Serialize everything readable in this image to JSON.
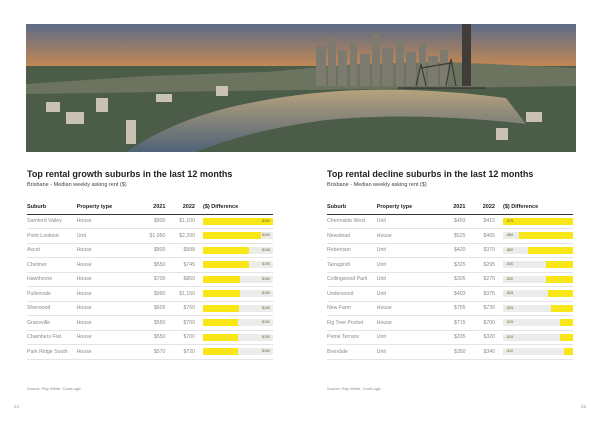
{
  "growth": {
    "title": "Top rental growth suburbs in the last 12 months",
    "subtitle": "Brisbane - Median weekly asking rent ($)",
    "headers": {
      "suburb": "Suburb",
      "type": "Property type",
      "y2021": "2021",
      "y2022": "2022",
      "diff": "($) Difference"
    },
    "rows": [
      {
        "suburb": "Samford Valley",
        "type": "House",
        "y2021": "$800",
        "y2022": "$1,100",
        "diff": "$300",
        "fill": 1.0
      },
      {
        "suburb": "Point Lookout",
        "type": "Unit",
        "y2021": "$1,950",
        "y2022": "$2,200",
        "diff": "$250",
        "fill": 0.83
      },
      {
        "suburb": "Ascot",
        "type": "House",
        "y2021": "$800",
        "y2022": "$998",
        "diff": "$198",
        "fill": 0.66
      },
      {
        "suburb": "Chelmer",
        "type": "House",
        "y2021": "$550",
        "y2022": "$745",
        "diff": "$195",
        "fill": 0.65
      },
      {
        "suburb": "Hawthorne",
        "type": "House",
        "y2021": "$700",
        "y2022": "$860",
        "diff": "$160",
        "fill": 0.53
      },
      {
        "suburb": "Pullenvale",
        "type": "House",
        "y2021": "$990",
        "y2022": "$1,150",
        "diff": "$160",
        "fill": 0.53
      },
      {
        "suburb": "Sherwood",
        "type": "House",
        "y2021": "$605",
        "y2022": "$760",
        "diff": "$155",
        "fill": 0.52
      },
      {
        "suburb": "Graceville",
        "type": "House",
        "y2021": "$550",
        "y2022": "$700",
        "diff": "$150",
        "fill": 0.5
      },
      {
        "suburb": "Chambers Flat",
        "type": "House",
        "y2021": "$550",
        "y2022": "$700",
        "diff": "$150",
        "fill": 0.5
      },
      {
        "suburb": "Park Ridge South",
        "type": "House",
        "y2021": "$570",
        "y2022": "$720",
        "diff": "$150",
        "fill": 0.5
      }
    ],
    "source": "Source: Ray White, CoreLogic",
    "page": "24"
  },
  "decline": {
    "title": "Top rental decline suburbs in the last 12 months",
    "subtitle": "Brisbane - Median weekly asking rent ($)",
    "headers": {
      "suburb": "Suburb",
      "type": "Property type",
      "y2021": "2021",
      "y2022": "2022",
      "diff": "($) Difference"
    },
    "rows": [
      {
        "suburb": "Chermside West",
        "type": "Unit",
        "y2021": "$493",
        "y2022": "$415",
        "diff": "-$78",
        "fill": 1.0
      },
      {
        "suburb": "Newstead",
        "type": "House",
        "y2021": "$525",
        "y2022": "$465",
        "diff": "-$60",
        "fill": 0.77
      },
      {
        "suburb": "Robertson",
        "type": "Unit",
        "y2021": "$420",
        "y2022": "$370",
        "diff": "-$50",
        "fill": 0.64
      },
      {
        "suburb": "Tarragindi",
        "type": "Unit",
        "y2021": "$325",
        "y2022": "$295",
        "diff": "-$30",
        "fill": 0.38
      },
      {
        "suburb": "Collingwood Park",
        "type": "Unit",
        "y2021": "$305",
        "y2022": "$275",
        "diff": "-$30",
        "fill": 0.38
      },
      {
        "suburb": "Underwood",
        "type": "Unit",
        "y2021": "$403",
        "y2022": "$375",
        "diff": "-$28",
        "fill": 0.36
      },
      {
        "suburb": "New Farm",
        "type": "House",
        "y2021": "$755",
        "y2022": "$730",
        "diff": "-$25",
        "fill": 0.32
      },
      {
        "suburb": "Fig Tree Pocket",
        "type": "House",
        "y2021": "$715",
        "y2022": "$700",
        "diff": "-$15",
        "fill": 0.19
      },
      {
        "suburb": "Petrie Terrace",
        "type": "Unit",
        "y2021": "$335",
        "y2022": "$320",
        "diff": "-$15",
        "fill": 0.19
      },
      {
        "suburb": "Brendale",
        "type": "Unit",
        "y2021": "$350",
        "y2022": "$340",
        "diff": "-$10",
        "fill": 0.13
      }
    ],
    "source": "Source: Ray White, CoreLogic",
    "page": "25"
  },
  "colors": {
    "bar": "#f8e617",
    "track": "#ececec"
  }
}
